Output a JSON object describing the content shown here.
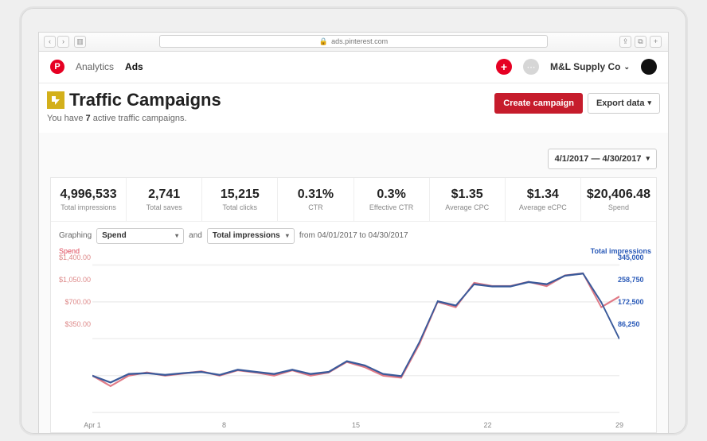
{
  "browser": {
    "url": "ads.pinterest.com"
  },
  "nav": {
    "analytics": "Analytics",
    "ads": "Ads",
    "account": "M&L Supply Co"
  },
  "header": {
    "title": "Traffic Campaigns",
    "sub_prefix": "You have ",
    "sub_count": "7",
    "sub_suffix": " active traffic campaigns.",
    "create": "Create campaign",
    "export": "Export data"
  },
  "date_range": "4/1/2017 — 4/30/2017",
  "metrics": [
    {
      "val": "4,996,533",
      "lbl": "Total impressions"
    },
    {
      "val": "2,741",
      "lbl": "Total saves"
    },
    {
      "val": "15,215",
      "lbl": "Total clicks"
    },
    {
      "val": "0.31%",
      "lbl": "CTR"
    },
    {
      "val": "0.3%",
      "lbl": "Effective CTR"
    },
    {
      "val": "$1.35",
      "lbl": "Average CPC"
    },
    {
      "val": "$1.34",
      "lbl": "Average eCPC"
    },
    {
      "val": "$20,406.48",
      "lbl": "Spend"
    }
  ],
  "graphing": {
    "label": "Graphing",
    "metric_a": "Spend",
    "and": "and",
    "metric_b": "Total impressions",
    "range_text": "from 04/01/2017 to 04/30/2017"
  },
  "axes": {
    "left_title": "Spend",
    "right_title": "Total impressions",
    "left_ticks": [
      "$1,400.00",
      "$1,050.00",
      "$700.00",
      "$350.00"
    ],
    "right_ticks": [
      "345,000",
      "258,750",
      "172,500",
      "86,250"
    ],
    "x_ticks": [
      "Apr 1",
      "8",
      "15",
      "22",
      "29"
    ]
  },
  "chart_data": {
    "type": "line",
    "x": [
      1,
      2,
      3,
      4,
      5,
      6,
      7,
      8,
      9,
      10,
      11,
      12,
      13,
      14,
      15,
      16,
      17,
      18,
      19,
      20,
      21,
      22,
      23,
      24,
      25,
      26,
      27,
      28,
      29,
      30
    ],
    "xlabel": "",
    "x_tick_labels": [
      "Apr 1",
      "8",
      "15",
      "22",
      "29"
    ],
    "series": [
      {
        "name": "Spend",
        "axis": "left",
        "ylabel": "Spend",
        "ylim": [
          0,
          1400
        ],
        "values": [
          350,
          250,
          350,
          380,
          350,
          370,
          390,
          350,
          400,
          380,
          350,
          400,
          350,
          380,
          480,
          430,
          350,
          330,
          650,
          1050,
          1000,
          1230,
          1200,
          1200,
          1240,
          1200,
          1300,
          1320,
          1000,
          1100
        ]
      },
      {
        "name": "Total impressions",
        "axis": "right",
        "ylabel": "Total impressions",
        "ylim": [
          0,
          345000
        ],
        "values": [
          86000,
          70000,
          90000,
          92000,
          88000,
          92000,
          95000,
          88000,
          100000,
          95000,
          90000,
          100000,
          90000,
          95000,
          120000,
          110000,
          90000,
          85000,
          165000,
          260000,
          250000,
          300000,
          295000,
          295000,
          305000,
          300000,
          320000,
          325000,
          258000,
          172000
        ]
      }
    ]
  }
}
